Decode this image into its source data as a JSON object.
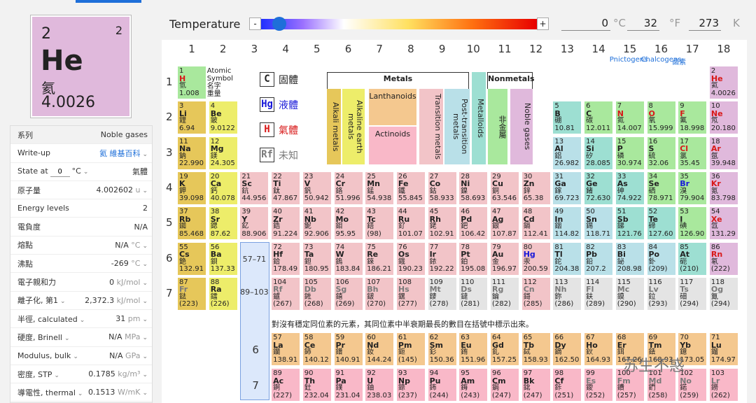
{
  "selected": {
    "number": "2",
    "valence": "2",
    "symbol": "He",
    "chinese": "氦",
    "mass": "4.0026"
  },
  "temperature": {
    "label": "Temperature",
    "minus": "-",
    "plus": "+",
    "celsius": "0",
    "c_unit": "°C",
    "fahrenheit": "32",
    "f_unit": "°F",
    "kelvin": "273",
    "k_unit": "K"
  },
  "sidebar": [
    {
      "label": "系列",
      "value": "Noble gases",
      "head": true
    },
    {
      "label": "Write-up",
      "value": "氦 維基百科",
      "chev": true,
      "link": true
    },
    {
      "label": "State at",
      "input": "0",
      "unit_sel": "°C",
      "value": "氣體"
    },
    {
      "label": "原子量",
      "value": "4.002602",
      "unit": "u",
      "chev": true
    },
    {
      "label": "Energy levels",
      "value": "2"
    },
    {
      "label": "電負度",
      "value": "N/A"
    },
    {
      "label": "熔點",
      "value": "N/A",
      "unit": "°C",
      "chev": true
    },
    {
      "label": "沸點",
      "value": "-269",
      "unit": "°C",
      "chev": true
    },
    {
      "label": "電子親和力",
      "value": "0",
      "unit": "kJ/mol",
      "chev": true
    },
    {
      "label": "離子化, 第1",
      "label_chev": true,
      "value": "2,372.3",
      "unit": "kJ/mol",
      "chev": true
    },
    {
      "label": "半徑, calculated",
      "label_chev": true,
      "value": "31",
      "unit": "pm",
      "chev": true
    },
    {
      "label": "硬度, Brinell",
      "label_chev": true,
      "value": "N/A",
      "unit": "MPa",
      "chev": true
    },
    {
      "label": "Modulus, bulk",
      "label_chev": true,
      "value": "N/A",
      "unit": "GPa",
      "chev": true
    },
    {
      "label": "密度, STP",
      "label_chev": true,
      "value": "0.1785",
      "unit": "kg/m³",
      "chev": true
    },
    {
      "label": "導電性, thermal",
      "label_chev": true,
      "value": "0.1513",
      "unit": "W/mK",
      "chev": true
    }
  ],
  "groups": [
    "1",
    "2",
    "3",
    "4",
    "5",
    "6",
    "7",
    "8",
    "9",
    "10",
    "11",
    "12",
    "13",
    "14",
    "15",
    "16",
    "17",
    "18"
  ],
  "periods": [
    "1",
    "2",
    "3",
    "4",
    "5",
    "6",
    "7"
  ],
  "group_names": {
    "pnictogens": "Pnictogens",
    "chalcogens": "Chalcogens",
    "halogens": "鹵素"
  },
  "legend": {
    "key": {
      "line1": "Atomic",
      "line2": "Symbol",
      "line3": "名字",
      "line4": "重量"
    },
    "key_example": {
      "n": "1",
      "s": "H",
      "c": "氫",
      "m": "1.008"
    },
    "metals": "Metals",
    "nonmetals": "Nonmetals",
    "metalloids": "Metalloids",
    "alkali": "Alkali metals",
    "alkaline": "Alkaline earth metals",
    "lanthanoids": "Lanthanoids",
    "actinoids": "Actinoids",
    "transition": "Transition metals",
    "post": "Post-transition metals",
    "nonmetal": "非金屬",
    "noble": "Noble gases",
    "states": [
      {
        "k": "C",
        "t": "固體",
        "cls": ""
      },
      {
        "k": "Hg",
        "t": "液體",
        "cls": "sym-b"
      },
      {
        "k": "H",
        "t": "氣體",
        "cls": "sym-r"
      },
      {
        "k": "Rf",
        "t": "未知",
        "cls": "sym-g"
      }
    ]
  },
  "ref_lanth": "57–71",
  "ref_actin": "89–103",
  "note": "對沒有穩定同位素的元素，其同位素中半衰期最長的數目在括號中標示出來。",
  "watermark": "苏生不惑",
  "elements": [
    {
      "n": "1",
      "s": "H",
      "c": "氫",
      "m": "1.008",
      "g": 1,
      "p": 1,
      "t": "nonmetal",
      "st": "r"
    },
    {
      "n": "2",
      "s": "He",
      "c": "氦",
      "m": "4.0026",
      "g": 18,
      "p": 1,
      "t": "noble",
      "st": "r"
    },
    {
      "n": "3",
      "s": "Li",
      "c": "鋰",
      "m": "6.94",
      "g": 1,
      "p": 2,
      "t": "alkali"
    },
    {
      "n": "4",
      "s": "Be",
      "c": "鈹",
      "m": "9.0122",
      "g": 2,
      "p": 2,
      "t": "alkaline"
    },
    {
      "n": "5",
      "s": "B",
      "c": "硼",
      "m": "10.81",
      "g": 13,
      "p": 2,
      "t": "metalloid"
    },
    {
      "n": "6",
      "s": "C",
      "c": "碳",
      "m": "12.011",
      "g": 14,
      "p": 2,
      "t": "nonmetal"
    },
    {
      "n": "7",
      "s": "N",
      "c": "氮",
      "m": "14.007",
      "g": 15,
      "p": 2,
      "t": "nonmetal",
      "st": "r"
    },
    {
      "n": "8",
      "s": "O",
      "c": "氧",
      "m": "15.999",
      "g": 16,
      "p": 2,
      "t": "nonmetal",
      "st": "r"
    },
    {
      "n": "9",
      "s": "F",
      "c": "氟",
      "m": "18.998",
      "g": 17,
      "p": 2,
      "t": "nonmetal",
      "st": "r"
    },
    {
      "n": "10",
      "s": "Ne",
      "c": "氖",
      "m": "20.180",
      "g": 18,
      "p": 2,
      "t": "noble",
      "st": "r"
    },
    {
      "n": "11",
      "s": "Na",
      "c": "鈉",
      "m": "22.990",
      "g": 1,
      "p": 3,
      "t": "alkali"
    },
    {
      "n": "12",
      "s": "Mg",
      "c": "鎂",
      "m": "24.305",
      "g": 2,
      "p": 3,
      "t": "alkaline"
    },
    {
      "n": "13",
      "s": "Al",
      "c": "鋁",
      "m": "26.982",
      "g": 13,
      "p": 3,
      "t": "post"
    },
    {
      "n": "14",
      "s": "Si",
      "c": "矽",
      "m": "28.085",
      "g": 14,
      "p": 3,
      "t": "metalloid"
    },
    {
      "n": "15",
      "s": "P",
      "c": "磷",
      "m": "30.974",
      "g": 15,
      "p": 3,
      "t": "nonmetal"
    },
    {
      "n": "16",
      "s": "S",
      "c": "硫",
      "m": "32.06",
      "g": 16,
      "p": 3,
      "t": "nonmetal"
    },
    {
      "n": "17",
      "s": "Cl",
      "c": "氯",
      "m": "35.45",
      "g": 17,
      "p": 3,
      "t": "nonmetal",
      "st": "r"
    },
    {
      "n": "18",
      "s": "Ar",
      "c": "氬",
      "m": "39.948",
      "g": 18,
      "p": 3,
      "t": "noble",
      "st": "r"
    },
    {
      "n": "19",
      "s": "K",
      "c": "鉀",
      "m": "39.098",
      "g": 1,
      "p": 4,
      "t": "alkali"
    },
    {
      "n": "20",
      "s": "Ca",
      "c": "鈣",
      "m": "40.078",
      "g": 2,
      "p": 4,
      "t": "alkaline"
    },
    {
      "n": "21",
      "s": "Sc",
      "c": "鈧",
      "m": "44.956",
      "g": 3,
      "p": 4,
      "t": "trans"
    },
    {
      "n": "22",
      "s": "Ti",
      "c": "鈦",
      "m": "47.867",
      "g": 4,
      "p": 4,
      "t": "trans"
    },
    {
      "n": "23",
      "s": "V",
      "c": "釩",
      "m": "50.942",
      "g": 5,
      "p": 4,
      "t": "trans"
    },
    {
      "n": "24",
      "s": "Cr",
      "c": "鉻",
      "m": "51.996",
      "g": 6,
      "p": 4,
      "t": "trans"
    },
    {
      "n": "25",
      "s": "Mn",
      "c": "錳",
      "m": "54.938",
      "g": 7,
      "p": 4,
      "t": "trans"
    },
    {
      "n": "26",
      "s": "Fe",
      "c": "鐵",
      "m": "55.845",
      "g": 8,
      "p": 4,
      "t": "trans"
    },
    {
      "n": "27",
      "s": "Co",
      "c": "鈷",
      "m": "58.933",
      "g": 9,
      "p": 4,
      "t": "trans"
    },
    {
      "n": "28",
      "s": "Ni",
      "c": "鎳",
      "m": "58.693",
      "g": 10,
      "p": 4,
      "t": "trans"
    },
    {
      "n": "29",
      "s": "Cu",
      "c": "銅",
      "m": "63.546",
      "g": 11,
      "p": 4,
      "t": "trans"
    },
    {
      "n": "30",
      "s": "Zn",
      "c": "鋅",
      "m": "65.38",
      "g": 12,
      "p": 4,
      "t": "trans"
    },
    {
      "n": "31",
      "s": "Ga",
      "c": "鎵",
      "m": "69.723",
      "g": 13,
      "p": 4,
      "t": "post"
    },
    {
      "n": "32",
      "s": "Ge",
      "c": "鍺",
      "m": "72.630",
      "g": 14,
      "p": 4,
      "t": "metalloid"
    },
    {
      "n": "33",
      "s": "As",
      "c": "砷",
      "m": "74.922",
      "g": 15,
      "p": 4,
      "t": "metalloid"
    },
    {
      "n": "34",
      "s": "Se",
      "c": "硒",
      "m": "78.971",
      "g": 16,
      "p": 4,
      "t": "nonmetal"
    },
    {
      "n": "35",
      "s": "Br",
      "c": "溴",
      "m": "79.904",
      "g": 17,
      "p": 4,
      "t": "nonmetal",
      "st": "b"
    },
    {
      "n": "36",
      "s": "Kr",
      "c": "氪",
      "m": "83.798",
      "g": 18,
      "p": 4,
      "t": "noble",
      "st": "r"
    },
    {
      "n": "37",
      "s": "Rb",
      "c": "銣",
      "m": "85.468",
      "g": 1,
      "p": 5,
      "t": "alkali"
    },
    {
      "n": "38",
      "s": "Sr",
      "c": "鍶",
      "m": "87.62",
      "g": 2,
      "p": 5,
      "t": "alkaline"
    },
    {
      "n": "39",
      "s": "Y",
      "c": "釔",
      "m": "88.906",
      "g": 3,
      "p": 5,
      "t": "trans"
    },
    {
      "n": "40",
      "s": "Zr",
      "c": "鋯",
      "m": "91.224",
      "g": 4,
      "p": 5,
      "t": "trans"
    },
    {
      "n": "41",
      "s": "Nb",
      "c": "鈮",
      "m": "92.906",
      "g": 5,
      "p": 5,
      "t": "trans"
    },
    {
      "n": "42",
      "s": "Mo",
      "c": "鉬",
      "m": "95.95",
      "g": 6,
      "p": 5,
      "t": "trans"
    },
    {
      "n": "43",
      "s": "Tc",
      "c": "鎝",
      "m": "(98)",
      "g": 7,
      "p": 5,
      "t": "trans"
    },
    {
      "n": "44",
      "s": "Ru",
      "c": "釕",
      "m": "101.07",
      "g": 8,
      "p": 5,
      "t": "trans"
    },
    {
      "n": "45",
      "s": "Rh",
      "c": "銠",
      "m": "102.91",
      "g": 9,
      "p": 5,
      "t": "trans"
    },
    {
      "n": "46",
      "s": "Pd",
      "c": "鈀",
      "m": "106.42",
      "g": 10,
      "p": 5,
      "t": "trans"
    },
    {
      "n": "47",
      "s": "Ag",
      "c": "銀",
      "m": "107.87",
      "g": 11,
      "p": 5,
      "t": "trans"
    },
    {
      "n": "48",
      "s": "Cd",
      "c": "鎘",
      "m": "112.41",
      "g": 12,
      "p": 5,
      "t": "trans"
    },
    {
      "n": "49",
      "s": "In",
      "c": "銦",
      "m": "114.82",
      "g": 13,
      "p": 5,
      "t": "post"
    },
    {
      "n": "50",
      "s": "Sn",
      "c": "錫",
      "m": "118.71",
      "g": 14,
      "p": 5,
      "t": "post"
    },
    {
      "n": "51",
      "s": "Sb",
      "c": "銻",
      "m": "121.76",
      "g": 15,
      "p": 5,
      "t": "metalloid"
    },
    {
      "n": "52",
      "s": "Te",
      "c": "碲",
      "m": "127.60",
      "g": 16,
      "p": 5,
      "t": "metalloid"
    },
    {
      "n": "53",
      "s": "I",
      "c": "碘",
      "m": "126.90",
      "g": 17,
      "p": 5,
      "t": "nonmetal"
    },
    {
      "n": "54",
      "s": "Xe",
      "c": "氙",
      "m": "131.29",
      "g": 18,
      "p": 5,
      "t": "noble",
      "st": "r"
    },
    {
      "n": "55",
      "s": "Cs",
      "c": "銫",
      "m": "132.91",
      "g": 1,
      "p": 6,
      "t": "alkali"
    },
    {
      "n": "56",
      "s": "Ba",
      "c": "鋇",
      "m": "137.33",
      "g": 2,
      "p": 6,
      "t": "alkaline"
    },
    {
      "n": "72",
      "s": "Hf",
      "c": "鉿",
      "m": "178.49",
      "g": 4,
      "p": 6,
      "t": "trans"
    },
    {
      "n": "73",
      "s": "Ta",
      "c": "鉭",
      "m": "180.95",
      "g": 5,
      "p": 6,
      "t": "trans"
    },
    {
      "n": "74",
      "s": "W",
      "c": "鎢",
      "m": "183.84",
      "g": 6,
      "p": 6,
      "t": "trans"
    },
    {
      "n": "75",
      "s": "Re",
      "c": "錸",
      "m": "186.21",
      "g": 7,
      "p": 6,
      "t": "trans"
    },
    {
      "n": "76",
      "s": "Os",
      "c": "鋨",
      "m": "190.23",
      "g": 8,
      "p": 6,
      "t": "trans"
    },
    {
      "n": "77",
      "s": "Ir",
      "c": "銥",
      "m": "192.22",
      "g": 9,
      "p": 6,
      "t": "trans"
    },
    {
      "n": "78",
      "s": "Pt",
      "c": "鉑",
      "m": "195.08",
      "g": 10,
      "p": 6,
      "t": "trans"
    },
    {
      "n": "79",
      "s": "Au",
      "c": "金",
      "m": "196.97",
      "g": 11,
      "p": 6,
      "t": "trans"
    },
    {
      "n": "80",
      "s": "Hg",
      "c": "汞",
      "m": "200.59",
      "g": 12,
      "p": 6,
      "t": "trans",
      "st": "b"
    },
    {
      "n": "81",
      "s": "Tl",
      "c": "鉈",
      "m": "204.38",
      "g": 13,
      "p": 6,
      "t": "post"
    },
    {
      "n": "82",
      "s": "Pb",
      "c": "鉛",
      "m": "207.2",
      "g": 14,
      "p": 6,
      "t": "post"
    },
    {
      "n": "83",
      "s": "Bi",
      "c": "鉍",
      "m": "208.98",
      "g": 15,
      "p": 6,
      "t": "post"
    },
    {
      "n": "84",
      "s": "Po",
      "c": "釙",
      "m": "(209)",
      "g": 16,
      "p": 6,
      "t": "post"
    },
    {
      "n": "85",
      "s": "At",
      "c": "砈",
      "m": "(210)",
      "g": 17,
      "p": 6,
      "t": "metalloid"
    },
    {
      "n": "86",
      "s": "Rn",
      "c": "氡",
      "m": "(222)",
      "g": 18,
      "p": 6,
      "t": "noble",
      "st": "r"
    },
    {
      "n": "87",
      "s": "Fr",
      "c": "鍅",
      "m": "(223)",
      "g": 1,
      "p": 7,
      "t": "alkali",
      "st": "g"
    },
    {
      "n": "88",
      "s": "Ra",
      "c": "鐳",
      "m": "(226)",
      "g": 2,
      "p": 7,
      "t": "alkaline"
    },
    {
      "n": "104",
      "s": "Rf",
      "c": "鑪",
      "m": "(267)",
      "g": 4,
      "p": 7,
      "t": "trans",
      "st": "g"
    },
    {
      "n": "105",
      "s": "Db",
      "c": "𨧀",
      "m": "(268)",
      "g": 5,
      "p": 7,
      "t": "trans",
      "st": "g"
    },
    {
      "n": "106",
      "s": "Sg",
      "c": "𨭎",
      "m": "(269)",
      "g": 6,
      "p": 7,
      "t": "trans",
      "st": "g"
    },
    {
      "n": "107",
      "s": "Bh",
      "c": "𨨏",
      "m": "(270)",
      "g": 7,
      "p": 7,
      "t": "trans",
      "st": "g"
    },
    {
      "n": "108",
      "s": "Hs",
      "c": "𨭆",
      "m": "(277)",
      "g": 8,
      "p": 7,
      "t": "trans",
      "st": "g"
    },
    {
      "n": "109",
      "s": "Mt",
      "c": "䥑",
      "m": "(278)",
      "g": 9,
      "p": 7,
      "t": "unknown",
      "st": "g"
    },
    {
      "n": "110",
      "s": "Ds",
      "c": "鐽",
      "m": "(281)",
      "g": 10,
      "p": 7,
      "t": "unknown",
      "st": "g"
    },
    {
      "n": "111",
      "s": "Rg",
      "c": "錀",
      "m": "(282)",
      "g": 11,
      "p": 7,
      "t": "unknown",
      "st": "g"
    },
    {
      "n": "112",
      "s": "Cn",
      "c": "鎶",
      "m": "(285)",
      "g": 12,
      "p": 7,
      "t": "trans",
      "st": "g"
    },
    {
      "n": "113",
      "s": "Nh",
      "c": "鉨",
      "m": "(286)",
      "g": 13,
      "p": 7,
      "t": "unknown",
      "st": "g"
    },
    {
      "n": "114",
      "s": "Fl",
      "c": "鈇",
      "m": "(289)",
      "g": 14,
      "p": 7,
      "t": "unknown",
      "st": "g"
    },
    {
      "n": "115",
      "s": "Mc",
      "c": "鏌",
      "m": "(290)",
      "g": 15,
      "p": 7,
      "t": "unknown",
      "st": "g"
    },
    {
      "n": "116",
      "s": "Lv",
      "c": "鉝",
      "m": "(293)",
      "g": 16,
      "p": 7,
      "t": "unknown",
      "st": "g"
    },
    {
      "n": "117",
      "s": "Ts",
      "c": "鿬",
      "m": "(294)",
      "g": 17,
      "p": 7,
      "t": "unknown",
      "st": "g"
    },
    {
      "n": "118",
      "s": "Og",
      "c": "鿫",
      "m": "(294)",
      "g": 18,
      "p": 7,
      "t": "unknown",
      "st": "g"
    },
    {
      "n": "57",
      "s": "La",
      "c": "鑭",
      "m": "138.91",
      "g": 4,
      "p": 9,
      "t": "lanth"
    },
    {
      "n": "58",
      "s": "Ce",
      "c": "鈰",
      "m": "140.12",
      "g": 5,
      "p": 9,
      "t": "lanth"
    },
    {
      "n": "59",
      "s": "Pr",
      "c": "鐠",
      "m": "140.91",
      "g": 6,
      "p": 9,
      "t": "lanth"
    },
    {
      "n": "60",
      "s": "Nd",
      "c": "釹",
      "m": "144.24",
      "g": 7,
      "p": 9,
      "t": "lanth"
    },
    {
      "n": "61",
      "s": "Pm",
      "c": "鉕",
      "m": "(145)",
      "g": 8,
      "p": 9,
      "t": "lanth"
    },
    {
      "n": "62",
      "s": "Sm",
      "c": "釤",
      "m": "150.36",
      "g": 9,
      "p": 9,
      "t": "lanth"
    },
    {
      "n": "63",
      "s": "Eu",
      "c": "銪",
      "m": "151.96",
      "g": 10,
      "p": 9,
      "t": "lanth"
    },
    {
      "n": "64",
      "s": "Gd",
      "c": "釓",
      "m": "157.25",
      "g": 11,
      "p": 9,
      "t": "lanth"
    },
    {
      "n": "65",
      "s": "Tb",
      "c": "鋱",
      "m": "158.93",
      "g": 12,
      "p": 9,
      "t": "lanth"
    },
    {
      "n": "66",
      "s": "Dy",
      "c": "鏑",
      "m": "162.50",
      "g": 13,
      "p": 9,
      "t": "lanth"
    },
    {
      "n": "67",
      "s": "Ho",
      "c": "鈥",
      "m": "164.93",
      "g": 14,
      "p": 9,
      "t": "lanth"
    },
    {
      "n": "68",
      "s": "Er",
      "c": "鉺",
      "m": "167.26",
      "g": 15,
      "p": 9,
      "t": "lanth"
    },
    {
      "n": "69",
      "s": "Tm",
      "c": "銩",
      "m": "168.93",
      "g": 16,
      "p": 9,
      "t": "lanth"
    },
    {
      "n": "70",
      "s": "Yb",
      "c": "鐿",
      "m": "173.05",
      "g": 17,
      "p": 9,
      "t": "lanth"
    },
    {
      "n": "71",
      "s": "Lu",
      "c": "鎦",
      "m": "174.97",
      "g": 18,
      "p": 9,
      "t": "lanth"
    },
    {
      "n": "89",
      "s": "Ac",
      "c": "錒",
      "m": "(227)",
      "g": 4,
      "p": 10,
      "t": "actin"
    },
    {
      "n": "90",
      "s": "Th",
      "c": "釷",
      "m": "232.04",
      "g": 5,
      "p": 10,
      "t": "actin"
    },
    {
      "n": "91",
      "s": "Pa",
      "c": "鏷",
      "m": "231.04",
      "g": 6,
      "p": 10,
      "t": "actin"
    },
    {
      "n": "92",
      "s": "U",
      "c": "鈾",
      "m": "238.03",
      "g": 7,
      "p": 10,
      "t": "actin"
    },
    {
      "n": "93",
      "s": "Np",
      "c": "錼",
      "m": "(237)",
      "g": 8,
      "p": 10,
      "t": "actin"
    },
    {
      "n": "94",
      "s": "Pu",
      "c": "鈽",
      "m": "(244)",
      "g": 9,
      "p": 10,
      "t": "actin"
    },
    {
      "n": "95",
      "s": "Am",
      "c": "鋂",
      "m": "(243)",
      "g": 10,
      "p": 10,
      "t": "actin"
    },
    {
      "n": "96",
      "s": "Cm",
      "c": "鋦",
      "m": "(247)",
      "g": 11,
      "p": 10,
      "t": "actin"
    },
    {
      "n": "97",
      "s": "Bk",
      "c": "鉳",
      "m": "(247)",
      "g": 12,
      "p": 10,
      "t": "actin"
    },
    {
      "n": "98",
      "s": "Cf",
      "c": "鉲",
      "m": "(251)",
      "g": 13,
      "p": 10,
      "t": "actin"
    },
    {
      "n": "99",
      "s": "Es",
      "c": "鑀",
      "m": "(252)",
      "g": 14,
      "p": 10,
      "t": "actin",
      "st": "g"
    },
    {
      "n": "100",
      "s": "Fm",
      "c": "鐨",
      "m": "(257)",
      "g": 15,
      "p": 10,
      "t": "actin",
      "st": "g"
    },
    {
      "n": "101",
      "s": "Md",
      "c": "鍆",
      "m": "(258)",
      "g": 16,
      "p": 10,
      "t": "actin",
      "st": "g"
    },
    {
      "n": "102",
      "s": "No",
      "c": "鍩",
      "m": "(259)",
      "g": 17,
      "p": 10,
      "t": "actin",
      "st": "g"
    },
    {
      "n": "103",
      "s": "Lr",
      "c": "鐒",
      "m": "(262)",
      "g": 18,
      "p": 10,
      "t": "actin",
      "st": "g"
    }
  ]
}
